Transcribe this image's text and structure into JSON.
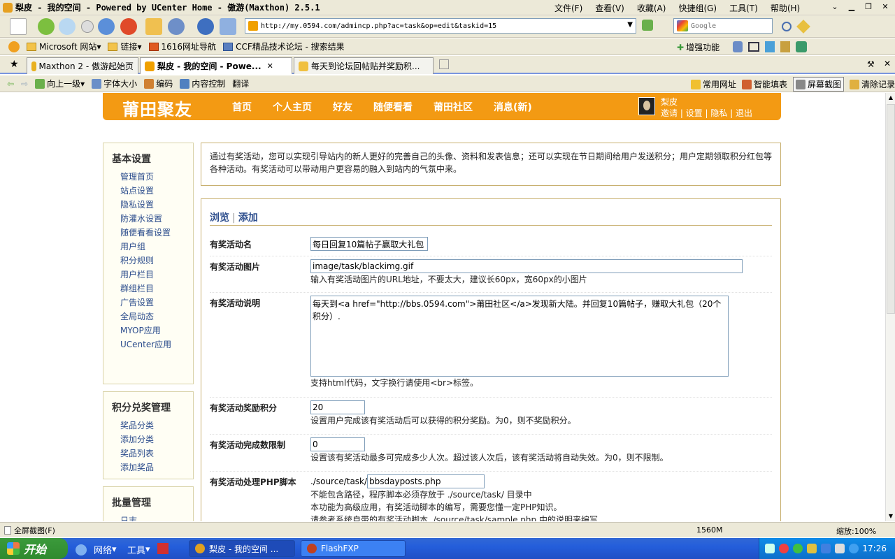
{
  "window": {
    "title": "梨皮 - 我的空间 - Powered by UCenter Home - 傲游(Maxthon) 2.5.1",
    "menus": [
      "文件(F)",
      "查看(V)",
      "收藏(A)",
      "快捷组(G)",
      "工具(T)",
      "帮助(H)"
    ]
  },
  "address": {
    "url": "http://my.0594.com/admincp.php?ac=task&op=edit&taskid=15"
  },
  "search": {
    "placeholder": "Google"
  },
  "favorites": {
    "items": [
      "Microsoft 网站",
      "链接",
      "1616网址导航",
      "CCF精品技术论坛 - 搜索结果"
    ],
    "enhance": "增强功能"
  },
  "tabs": [
    {
      "label": "Maxthon 2 - 傲游起始页"
    },
    {
      "label": "梨皮 - 我的空间 - Powe..."
    },
    {
      "label": "每天到论坛回帖贴并奖励积..."
    }
  ],
  "navbar": {
    "up": "向上一级",
    "font_size": "字体大小",
    "encoding": "编码",
    "content_control": "内容控制",
    "translate": "翻译",
    "common_sites": "常用网址",
    "smart_fill": "智能填表",
    "screenshot": "屏幕截图",
    "clear_history": "清除记录"
  },
  "site": {
    "logo": "莆田聚友",
    "nav": [
      "首页",
      "个人主页",
      "好友",
      "随便看看",
      "莆田社区",
      "消息(新)"
    ],
    "username": "梨皮",
    "user_links": "邀请 | 设置 | 隐私 | 退出"
  },
  "sidebar": {
    "basic": {
      "title": "基本设置",
      "items": [
        "管理首页",
        "站点设置",
        "隐私设置",
        "防灌水设置",
        "随便看看设置",
        "用户组",
        "积分规则",
        "用户栏目",
        "群组栏目",
        "广告设置",
        "全局动态",
        "MYOP应用",
        "UCenter应用"
      ]
    },
    "credit": {
      "title": "积分兑奖管理",
      "items": [
        "奖品分类",
        "添加分类",
        "奖品列表",
        "添加奖品"
      ]
    },
    "batch": {
      "title": "批量管理",
      "items": [
        "日志"
      ]
    }
  },
  "intro": "通过有奖活动，您可以实现引导站内的新人更好的完善自己的头像、资料和发表信息；还可以实现在节日期间给用户发送积分；用户定期领取积分红包等各种活动。有奖活动可以带动用户更容易的融入到站内的气氛中来。",
  "form": {
    "tab_browse": "浏览",
    "tab_add": "添加",
    "name_label": "有奖活动名",
    "name_value": "每日回复10篇帖子赢取大礼包",
    "image_label": "有奖活动图片",
    "image_value": "image/task/blackimg.gif",
    "image_help": "输入有奖活动图片的URL地址，不要太大，建议长60px，宽60px的小图片",
    "desc_label": "有奖活动说明",
    "desc_value": "每天到<a href=\"http://bbs.0594.com\">莆田社区</a>发现新大陆。并回复10篇帖子，赚取大礼包（20个积分）.",
    "desc_help": "支持html代码，文字换行请使用<br>标签。",
    "reward_label": "有奖活动奖励积分",
    "reward_value": "20",
    "reward_help": "设置用户完成该有奖活动后可以获得的积分奖励。为0，则不奖励积分。",
    "limit_label": "有奖活动完成数限制",
    "limit_value": "0",
    "limit_help": "设置该有奖活动最多可完成多少人次。超过该人次后，该有奖活动将自动失效。为0，则不限制。",
    "script_label": "有奖活动处理PHP脚本",
    "script_prefix": "./source/task/",
    "script_value": "bbsdayposts.php",
    "script_help1": "不能包含路径，程序脚本必须存放于 ./source/task/ 目录中",
    "script_help2": "本功能为高级应用，有奖活动脚本的编写，需要您懂一定PHP知识。",
    "script_help3": "请参考系统自带的有奖活动脚本 ./source/task/sample.php 中的说明来编写"
  },
  "status": {
    "text": "全屏截图(F)",
    "memory": "1560M",
    "zoom": "缩放:100%"
  },
  "taskbar": {
    "start": "开始",
    "quick": [
      "网络",
      "工具"
    ],
    "tasks": [
      "梨皮 - 我的空间 ...",
      "FlashFXP"
    ],
    "clock": "17:26"
  }
}
